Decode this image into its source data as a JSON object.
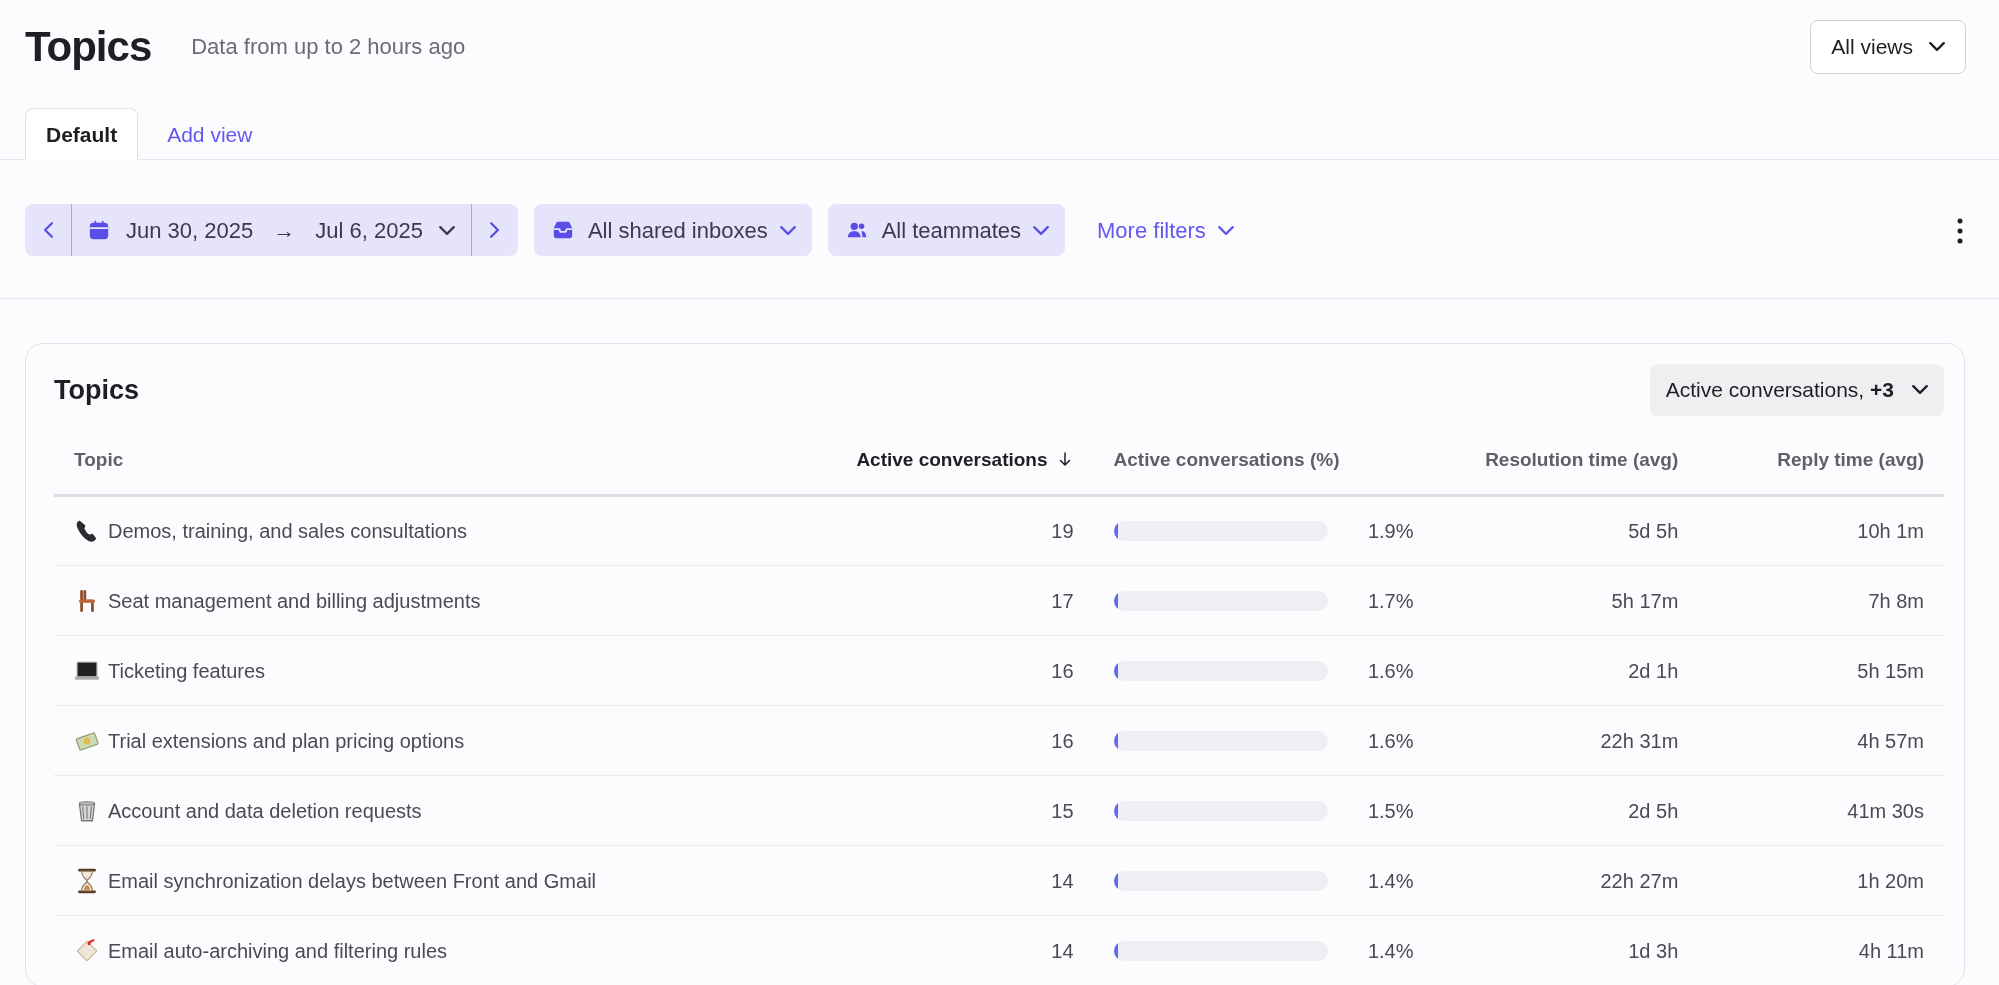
{
  "header": {
    "title": "Topics",
    "subtitle": "Data from up to 2 hours ago",
    "views_button": "All views"
  },
  "tabs": [
    {
      "label": "Default",
      "selected": true
    },
    {
      "label": "Add view",
      "selected": false
    }
  ],
  "filters": {
    "date_start": "Jun 30, 2025",
    "date_arrow": "→",
    "date_end": "Jul 6, 2025",
    "inboxes": "All shared inboxes",
    "teammates": "All teammates",
    "more": "More filters"
  },
  "card": {
    "title": "Topics",
    "metrics_button": "Active conversations, **+3**",
    "columns": [
      {
        "label": "Topic",
        "sorted": false
      },
      {
        "label": "Active conversations",
        "sorted": true
      },
      {
        "label": "Active conversations (%)",
        "sorted": false
      },
      {
        "label": "Resolution time (avg)",
        "sorted": false
      },
      {
        "label": "Reply time (avg)",
        "sorted": false
      }
    ],
    "rows": [
      {
        "kind": "phone",
        "topic": "Demos, training, and sales consultations",
        "count": "19",
        "level": 0.019,
        "percent": "1.9%",
        "resolution": "5d 5h",
        "reply": "10h 1m"
      },
      {
        "kind": "chair",
        "topic": "Seat management and billing adjustments",
        "count": "17",
        "level": 0.017,
        "percent": "1.7%",
        "resolution": "5h 17m",
        "reply": "7h 8m"
      },
      {
        "kind": "laptop",
        "topic": "Ticketing features",
        "count": "16",
        "level": 0.016,
        "percent": "1.6%",
        "resolution": "2d 1h",
        "reply": "5h 15m"
      },
      {
        "kind": "money",
        "topic": "Trial extensions and plan pricing options",
        "count": "16",
        "level": 0.016,
        "percent": "1.6%",
        "resolution": "22h 31m",
        "reply": "4h 57m"
      },
      {
        "kind": "bin",
        "topic": "Account and data deletion requests",
        "count": "15",
        "level": 0.015,
        "percent": "1.5%",
        "resolution": "2d 5h",
        "reply": "41m 30s"
      },
      {
        "kind": "hourglass",
        "topic": "Email synchronization delays between Front and Gmail",
        "count": "14",
        "level": 0.014,
        "percent": "1.4%",
        "resolution": "22h 27m",
        "reply": "1h 20m"
      },
      {
        "kind": "tag",
        "topic": "Email auto-archiving and filtering rules",
        "count": "14",
        "level": 0.014,
        "percent": "1.4%",
        "resolution": "1d 3h",
        "reply": "4h 11m"
      }
    ]
  }
}
